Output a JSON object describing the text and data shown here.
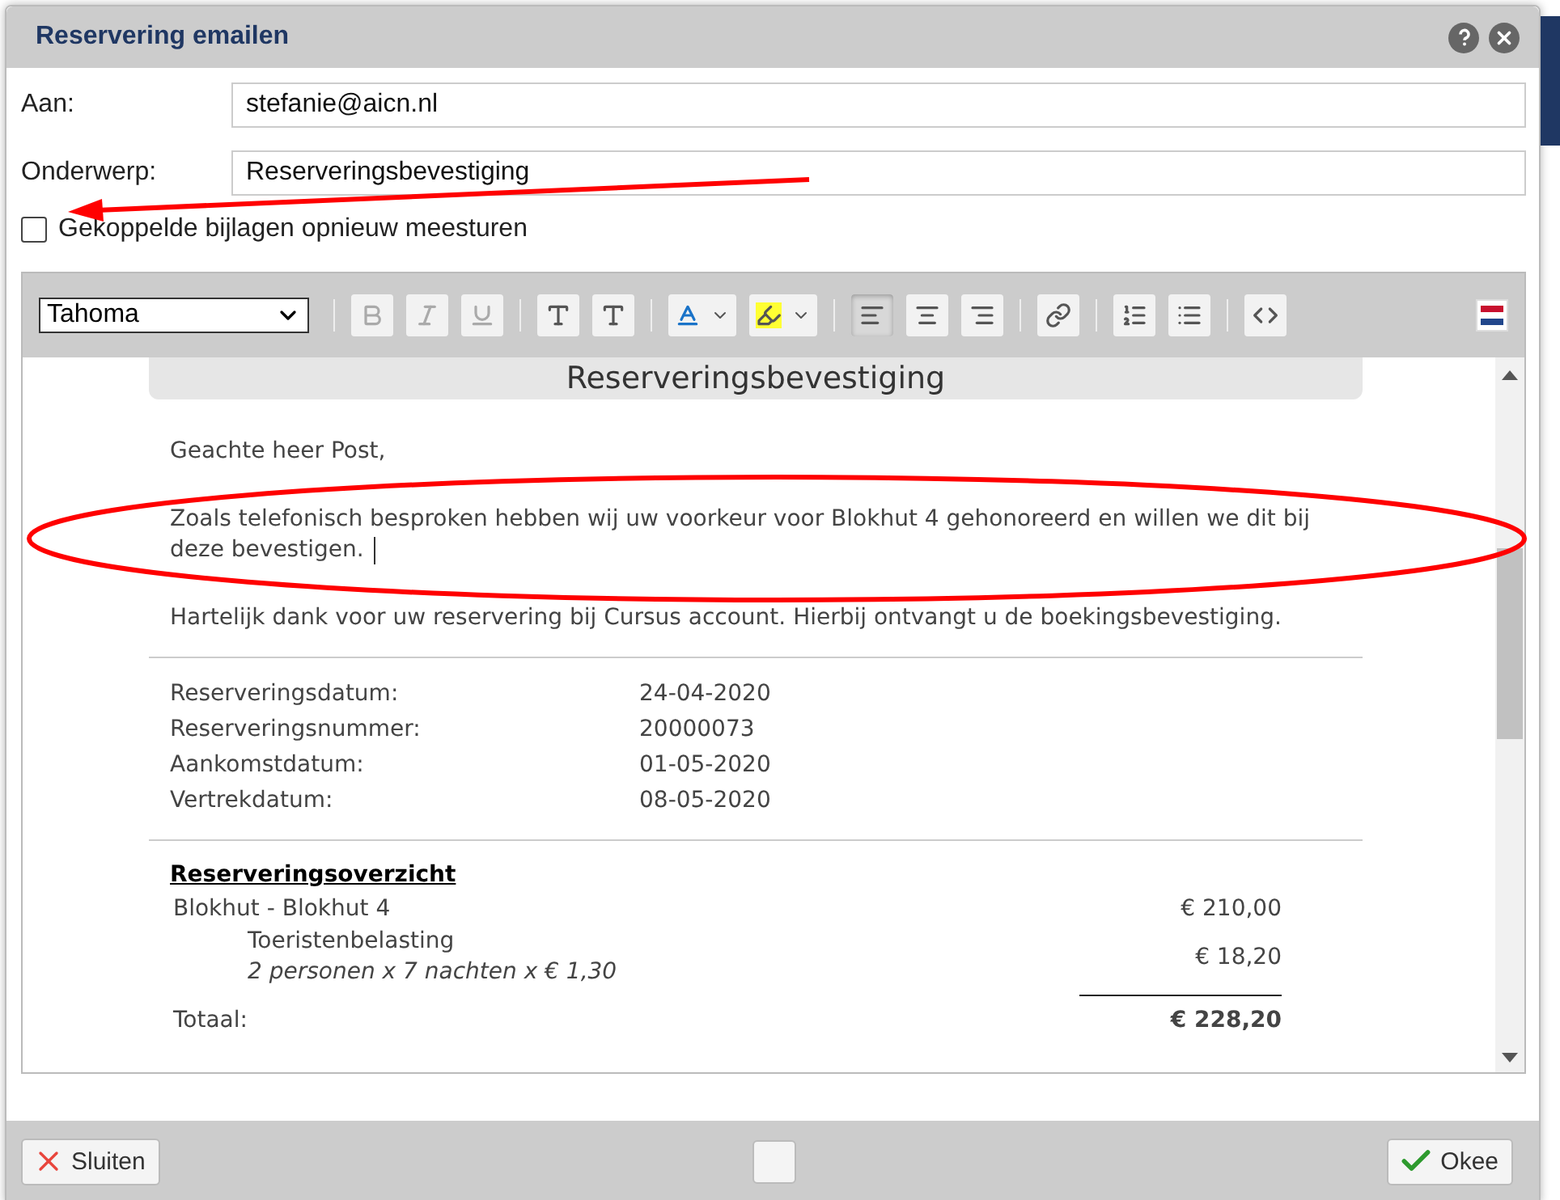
{
  "dialog": {
    "title": "Reservering emailen"
  },
  "fields": [
    {
      "label": "Aan:",
      "value": "stefanie@aicn.nl"
    },
    {
      "label": "Onderwerp:",
      "value": "Reserveringsbevestiging"
    }
  ],
  "attachments": {
    "label": "Gekoppelde bijlagen opnieuw meesturen",
    "checked": false
  },
  "toolbar": {
    "font": "Tahoma",
    "buttons": [
      {
        "disabled": true,
        "selected": false
      },
      {
        "disabled": true,
        "selected": false
      },
      {
        "disabled": true,
        "selected": false
      },
      {
        "disabled": false,
        "selected": false
      },
      {
        "disabled": false,
        "selected": false
      },
      {
        "disabled": false,
        "selected": false
      },
      {
        "disabled": false,
        "selected": false
      },
      {
        "disabled": false,
        "selected": true
      },
      {
        "disabled": false,
        "selected": false
      },
      {
        "disabled": false,
        "selected": false
      },
      {
        "disabled": false,
        "selected": false
      },
      {
        "disabled": false,
        "selected": false
      },
      {
        "disabled": false,
        "selected": false
      },
      {
        "disabled": false,
        "selected": false
      }
    ]
  },
  "message": {
    "heading": "Reserveringsbevestiging",
    "paragraphs": [
      "Geachte heer Post,",
      "Zoals telefonisch besproken hebben wij uw voorkeur voor Blokhut 4 gehonoreerd en willen we dit bij deze bevestigen.",
      "Hartelijk dank voor uw reservering bij Cursus account. Hierbij ontvangt u de boekingsbevestiging."
    ],
    "details": [
      {
        "label": "Reserveringsdatum:",
        "value": "24-04-2020"
      },
      {
        "label": "Reserveringsnummer:",
        "value": "20000073"
      },
      {
        "label": "Aankomstdatum:",
        "value": "01-05-2020"
      },
      {
        "label": "Vertrekdatum:",
        "value": "08-05-2020"
      }
    ],
    "overview": {
      "title": "Reserveringsoverzicht",
      "lines": [
        {
          "label": "Blokhut - Blokhut 4",
          "amount": "€ 210,00"
        },
        {
          "label": "Toeristenbelasting",
          "note": "2 personen x 7 nachten x € 1,30",
          "amount": "€ 18,20"
        }
      ],
      "total_label": "Totaal:",
      "total": "€ 228,20"
    }
  },
  "footer": {
    "close": "Sluiten",
    "ok": "Okee"
  }
}
